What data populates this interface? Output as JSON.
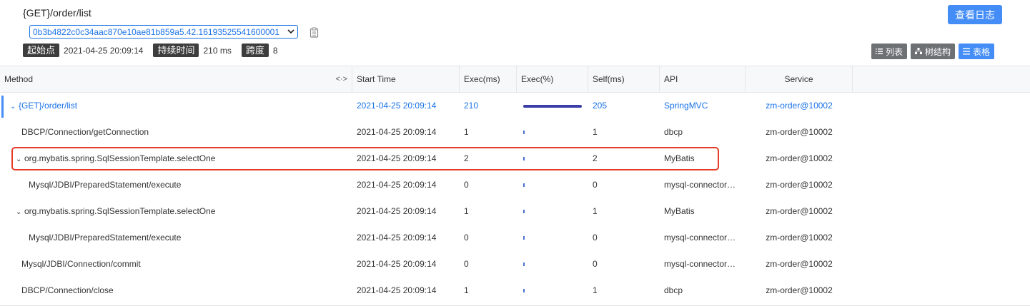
{
  "header": {
    "title": "{GET}/order/list",
    "log_button": "查看日志",
    "trace_id": "0b3b4822c0c34aac870e10ae81b859a5.42.16193525541600001",
    "meta": [
      {
        "label": "起始点",
        "value": "2021-04-25 20:09:14"
      },
      {
        "label": "持续时间",
        "value": "210 ms"
      },
      {
        "label": "跨度",
        "value": "8"
      }
    ],
    "view_buttons": [
      {
        "label": "列表",
        "icon": "list-icon",
        "active": false
      },
      {
        "label": "树结构",
        "icon": "tree-icon",
        "active": false
      },
      {
        "label": "表格",
        "icon": "table-icon",
        "active": true
      }
    ]
  },
  "table": {
    "columns": [
      "Method",
      "Start Time",
      "Exec(ms)",
      "Exec(%)",
      "Self(ms)",
      "API",
      "Service"
    ],
    "resize_glyph": "<·>",
    "rows": [
      {
        "method": "{GET}/order/list",
        "indent": 0,
        "caret": "⌄",
        "start": "2021-04-25 20:09:14",
        "exec": "210",
        "pct": 1.0,
        "self": "205",
        "api": "SpringMVC",
        "service": "zm-order@10002"
      },
      {
        "method": "DBCP/Connection/getConnection",
        "indent": 1,
        "caret": "",
        "start": "2021-04-25 20:09:14",
        "exec": "1",
        "pct": 0.005,
        "self": "1",
        "api": "dbcp",
        "service": "zm-order@10002"
      },
      {
        "method": "org.mybatis.spring.SqlSessionTemplate.selectOne",
        "indent": 1,
        "caret": "⌄",
        "start": "2021-04-25 20:09:14",
        "exec": "2",
        "pct": 0.01,
        "self": "2",
        "api": "MyBatis",
        "service": "zm-order@10002"
      },
      {
        "method": "Mysql/JDBI/PreparedStatement/execute",
        "indent": 2,
        "caret": "",
        "start": "2021-04-25 20:09:14",
        "exec": "0",
        "pct": 0.0,
        "self": "0",
        "api": "mysql-connector…",
        "service": "zm-order@10002"
      },
      {
        "method": "org.mybatis.spring.SqlSessionTemplate.selectOne",
        "indent": 1,
        "caret": "⌄",
        "start": "2021-04-25 20:09:14",
        "exec": "1",
        "pct": 0.005,
        "self": "1",
        "api": "MyBatis",
        "service": "zm-order@10002"
      },
      {
        "method": "Mysql/JDBI/PreparedStatement/execute",
        "indent": 2,
        "caret": "",
        "start": "2021-04-25 20:09:14",
        "exec": "0",
        "pct": 0.0,
        "self": "0",
        "api": "mysql-connector…",
        "service": "zm-order@10002"
      },
      {
        "method": "Mysql/JDBI/Connection/commit",
        "indent": 1,
        "caret": "",
        "start": "2021-04-25 20:09:14",
        "exec": "0",
        "pct": 0.0,
        "self": "0",
        "api": "mysql-connector…",
        "service": "zm-order@10002"
      },
      {
        "method": "DBCP/Connection/close",
        "indent": 1,
        "caret": "",
        "start": "2021-04-25 20:09:14",
        "exec": "1",
        "pct": 0.005,
        "self": "1",
        "api": "dbcp",
        "service": "zm-order@10002"
      }
    ]
  },
  "colors": {
    "accent": "#448df6",
    "link": "#1a73e8",
    "highlight": "#e53c28",
    "bar": "#3c3ea8"
  }
}
